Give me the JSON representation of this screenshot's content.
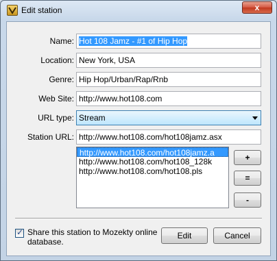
{
  "window": {
    "title": "Edit station",
    "close_glyph": "x"
  },
  "icons": {
    "app": "station-app-icon",
    "close": "close-icon"
  },
  "form": {
    "name": {
      "label": "Name:",
      "value": "Hot 108 Jamz - #1 of Hip Hop"
    },
    "location": {
      "label": "Location:",
      "value": "New York, USA"
    },
    "genre": {
      "label": "Genre:",
      "value": "Hip Hop/Urban/Rap/Rnb"
    },
    "website": {
      "label": "Web Site:",
      "value": "http://www.hot108.com"
    },
    "url_type": {
      "label": "URL type:",
      "value": "Stream"
    },
    "station_url": {
      "label": "Station URL:",
      "value": "http://www.hot108.com/hot108jamz.asx"
    }
  },
  "url_list": {
    "items": [
      "http://www.hot108.com/hot108jamz.a",
      "http://www.hot108.com/hot108_128k",
      "http://www.hot108.com/hot108.pls"
    ],
    "selected_index": 0
  },
  "list_buttons": {
    "add": "+",
    "equal": "=",
    "remove": "-"
  },
  "share": {
    "checked": true,
    "label": "Share this station to Mozekty online database."
  },
  "buttons": {
    "edit": "Edit",
    "cancel": "Cancel"
  },
  "colors": {
    "selection": "#3399ff",
    "close_button": "#c1391f"
  }
}
